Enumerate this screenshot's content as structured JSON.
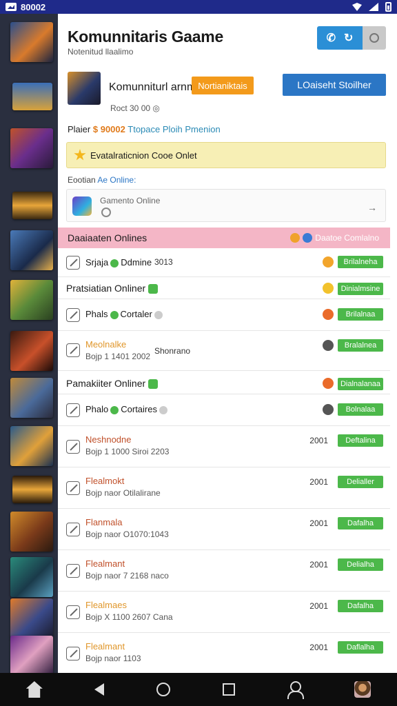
{
  "status_bar": {
    "app_label": "80002"
  },
  "header": {
    "title": "Komunnitaris Gaame",
    "subtitle": "Notenitud llaalimo"
  },
  "game": {
    "name": "Komunniturl arnme",
    "tag": "Nortianiktais",
    "action_button": "LOaiseht Stoilher",
    "meta": "Roct 30 00 ◎"
  },
  "player_line": {
    "label": "Plaier",
    "score": "$ 90002",
    "extra": "Ttopace Ploih Pmenion"
  },
  "banner": {
    "text": "Evatalraticnion Cooe Onlet"
  },
  "section": {
    "label": "Eootian",
    "link": "Ae Online:"
  },
  "online_card": {
    "title": "Gamento Online"
  },
  "pink_bar": {
    "title": "Daaiaaten Onlines",
    "right_label": "Daatoe Comlalno"
  },
  "rows": [
    {
      "name": "Srjaja",
      "middle": "Ddmine",
      "value": "3013",
      "chip": "Brilalneha",
      "emo": "#f2a52c"
    },
    {
      "group": "Pratsiatian Onliner",
      "chip": "Dinialmsine",
      "emo": "#f2c22c"
    },
    {
      "name": "Phals",
      "middle": "Cortaler",
      "value": "",
      "chip": "Brilalnaa",
      "emo": "#ea6b2a"
    },
    {
      "name": "Meolnalke",
      "sub": "Bojp  1 1401 2002",
      "value": "Shonrano",
      "chip": "Bralalnea",
      "emo": "#555"
    },
    {
      "group": "Pamakiiter Onliner",
      "chip": "Dialnalanaa",
      "emo": "#ea6b2a"
    },
    {
      "name": "Phalo",
      "middle": "Cortaires",
      "value": "",
      "chip": "Bolnalaa",
      "emo": "#555"
    },
    {
      "name": "Neshnodne",
      "sub": "Bojp  1 1000  Siroi 2203",
      "value": "2001",
      "chip": "Deftalina"
    },
    {
      "name": "Flealmokt",
      "sub": "Bojp  naor  Otilalirane",
      "value": "2001",
      "chip": "Delialler"
    },
    {
      "name": "Flanmala",
      "sub": "Bojp  naor  O1070:1043",
      "value": "2001",
      "chip": "Dafalha"
    },
    {
      "name": "Flealmant",
      "sub": "Bojp  naor  7 2168 naco",
      "value": "2001",
      "chip": "Delialha"
    },
    {
      "name": "Flealmaes",
      "sub": "Bojp  X 1100  2607 Cana",
      "value": "2001",
      "chip": "Dafalha"
    },
    {
      "name": "Flealmant",
      "sub": "Bojp  naor  1103",
      "value": "2001",
      "chip": "Daflalha"
    }
  ],
  "colors": {
    "status_bar": "#1f2a8a",
    "accent_blue": "#2b76c5",
    "tag_orange": "#f39a1b",
    "chip_green": "#4cb84a",
    "pink_bar": "#f4b6c6",
    "banner_yellow": "#f7efb5"
  }
}
